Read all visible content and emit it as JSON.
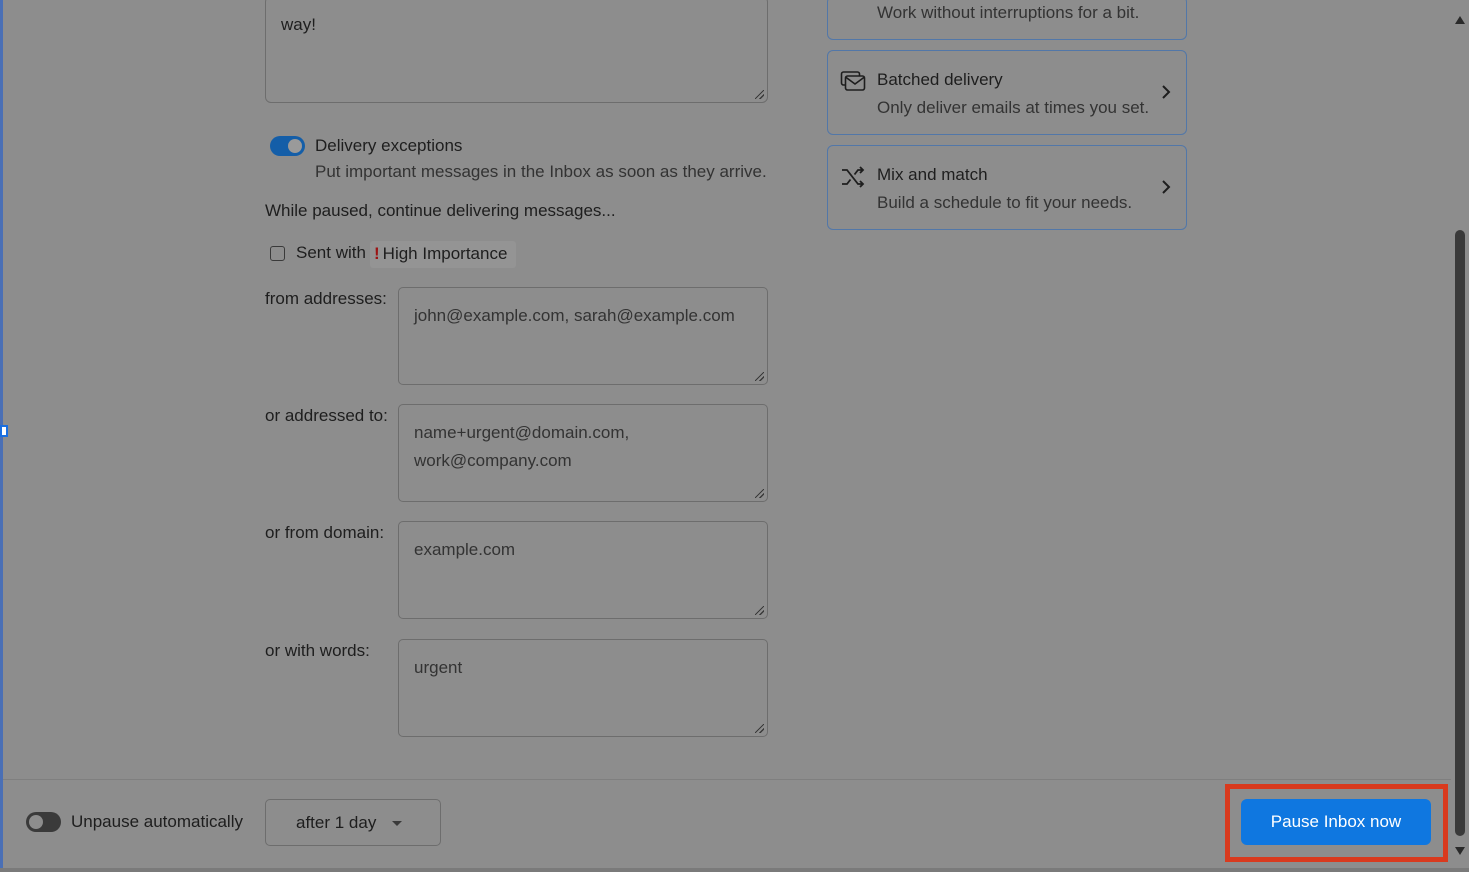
{
  "message_textarea": {
    "value": "way!"
  },
  "delivery_exceptions": {
    "title": "Delivery exceptions",
    "description": "Put important messages in the Inbox as soon as they arrive.",
    "enabled": true
  },
  "while_paused_text": "While paused, continue delivering messages...",
  "high_importance": {
    "prefix": "Sent with",
    "mark": "!",
    "label": "High Importance",
    "checked": false
  },
  "fields": {
    "from_addresses": {
      "label": "from addresses:",
      "placeholder": "john@example.com, sarah@example.com"
    },
    "addressed_to": {
      "label": "or addressed to:",
      "placeholder_line1": "name+urgent@domain.com,",
      "placeholder_line2": "work@company.com"
    },
    "from_domain": {
      "label": "or from domain:",
      "placeholder": "example.com"
    },
    "with_words": {
      "label": "or with words:",
      "placeholder": "urgent"
    }
  },
  "cards": [
    {
      "title": "",
      "description": "Work without interruptions for a bit."
    },
    {
      "title": "Batched delivery",
      "description": "Only deliver emails at times you set.",
      "icon": "batched-delivery-icon"
    },
    {
      "title": "Mix and match",
      "description": "Build a schedule to fit your needs.",
      "icon": "shuffle-icon"
    }
  ],
  "footer": {
    "unpause_label": "Unpause automatically",
    "unpause_enabled": false,
    "duration_value": "after 1 day",
    "primary_button": "Pause Inbox now"
  },
  "colors": {
    "overlay_background": "#8d8d8d",
    "primary_button": "#0f77e0",
    "highlight_border": "#d93a1e",
    "toggle_on": "#145ea8"
  }
}
